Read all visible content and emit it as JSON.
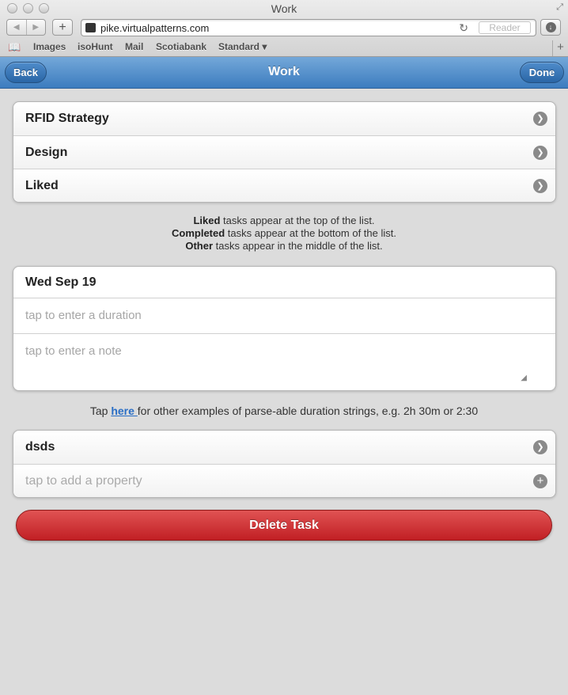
{
  "browser": {
    "window_title": "Work",
    "url": "pike.virtualpatterns.com",
    "reader_label": "Reader",
    "bookmarks": [
      "Images",
      "isoHunt",
      "Mail",
      "Scotiabank",
      "Standard ▾"
    ]
  },
  "header": {
    "title": "Work",
    "back_label": "Back",
    "done_label": "Done",
    "accent_color": "#3c7cbf"
  },
  "categories": [
    {
      "label": "RFID Strategy",
      "icon": "chevron-right-icon"
    },
    {
      "label": "Design",
      "icon": "chevron-right-icon"
    },
    {
      "label": "Liked",
      "icon": "chevron-right-icon"
    }
  ],
  "info": {
    "line1_bold": "Liked",
    "line1_rest": " tasks appear at the top of the list.",
    "line2_bold": "Completed",
    "line2_rest": " tasks appear at the bottom of the list.",
    "line3_bold": "Other",
    "line3_rest": " tasks appear in the middle of the list."
  },
  "form": {
    "date": "Wed Sep 19",
    "duration_placeholder": "tap to enter a duration",
    "note_placeholder": "tap to enter a note"
  },
  "tap_help": {
    "prefix": "Tap ",
    "link": "here ",
    "suffix": "for other examples of parse-able duration strings, e.g. 2h 30m or 2:30"
  },
  "properties": [
    {
      "label": "dsds",
      "icon": "chevron-right-icon"
    },
    {
      "label": "tap to add a property",
      "icon": "plus-icon"
    }
  ],
  "delete_label": "Delete Task",
  "delete_color": "#c11f24"
}
